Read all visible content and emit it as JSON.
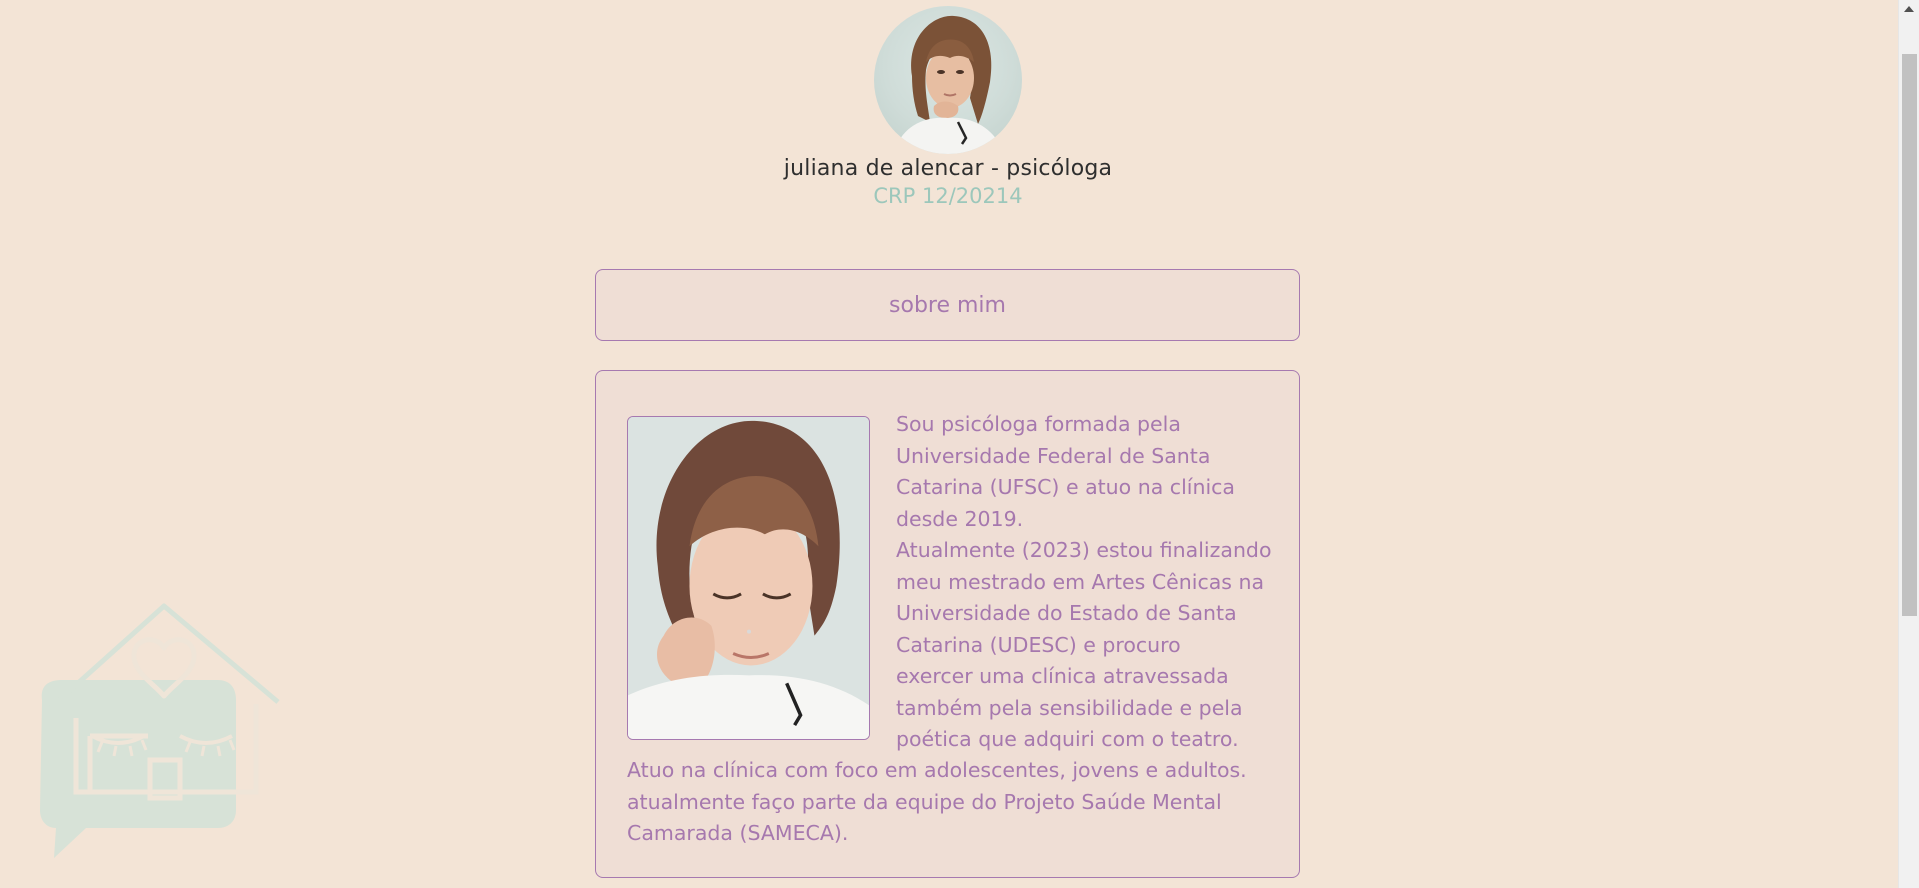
{
  "profile": {
    "name": "juliana de alencar - psicóloga",
    "crp": "CRP 12/20214"
  },
  "about_button": {
    "label": "sobre mim"
  },
  "bio": {
    "right_lines": [
      "Sou psicóloga formada pela",
      "Universidade Federal de Santa",
      "Catarina (UFSC) e atuo na clínica",
      "desde 2019.",
      "Atualmente (2023) estou finalizando",
      "meu mestrado em Artes Cênicas na",
      "Universidade do Estado de Santa",
      "Catarina (UDESC) e procuro",
      "exercer uma clínica atravessada",
      "também pela sensibilidade e pela",
      "poética que adquiri com o teatro."
    ],
    "bottom_lines": [
      "Atuo na clínica com foco em adolescentes, jovens e adultos.",
      "atualmente faço parte da equipe do Projeto Saúde Mental",
      "Camarada (SAMECA)."
    ]
  },
  "colors": {
    "background": "#f3e4d6",
    "accent_purple": "#a678ae",
    "accent_teal": "#9cc7bb",
    "card_bg": "#efded5"
  },
  "icons": {
    "decor": "house-heart-speech-bubble-icon",
    "scroll_up": "chevron-up-icon"
  }
}
